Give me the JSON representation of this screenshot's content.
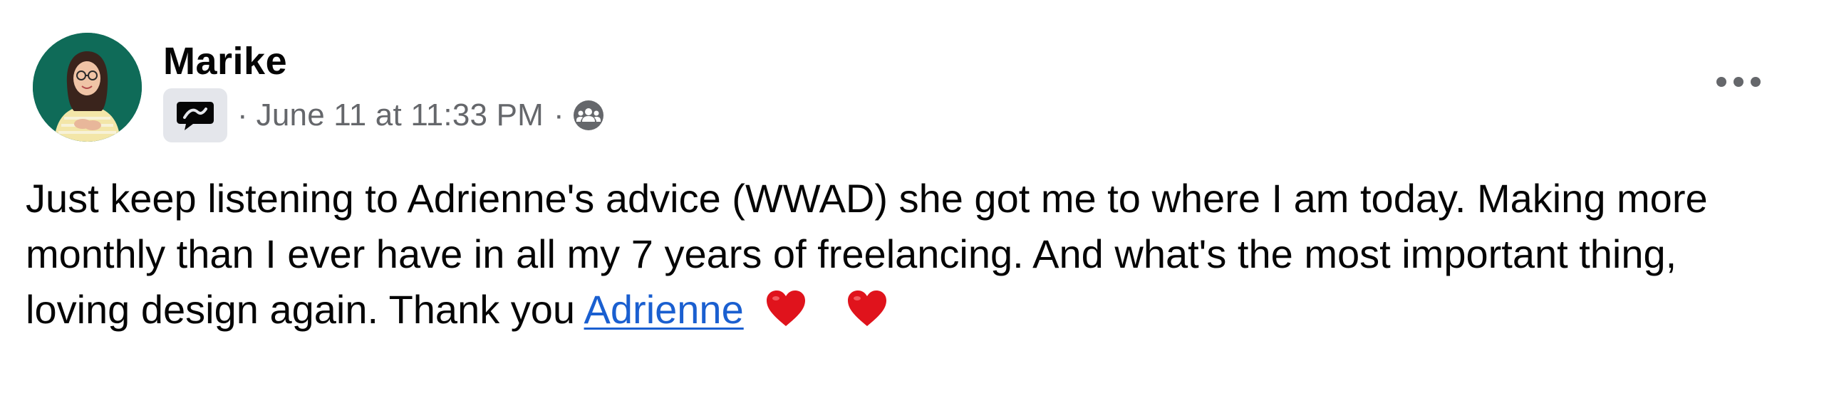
{
  "post": {
    "author": "Marike",
    "meta": {
      "separator": "·",
      "timestamp": "June 11 at 11:33 PM",
      "badge_icon": "message-bubble-icon",
      "audience_icon": "group-audience-icon"
    },
    "more_icon": "more-horizontal-icon",
    "body": {
      "line1": "Just keep listening to Adrienne's advice (WWAD) she got me to where I am today. Making more",
      "line2": "monthly than I ever have in all my 7 years of freelancing. And what's the most important thing,",
      "line3_prefix": "loving design again. Thank you ",
      "mention": "Adrienne",
      "emojis": [
        "heart-emoji",
        "heart-emoji"
      ]
    },
    "colors": {
      "avatar_bg": "#0f6b58",
      "mention": "#1a5fd0",
      "meta_text": "#65676b",
      "badge_bg": "#e4e6eb",
      "heart": "#e0131c"
    }
  }
}
